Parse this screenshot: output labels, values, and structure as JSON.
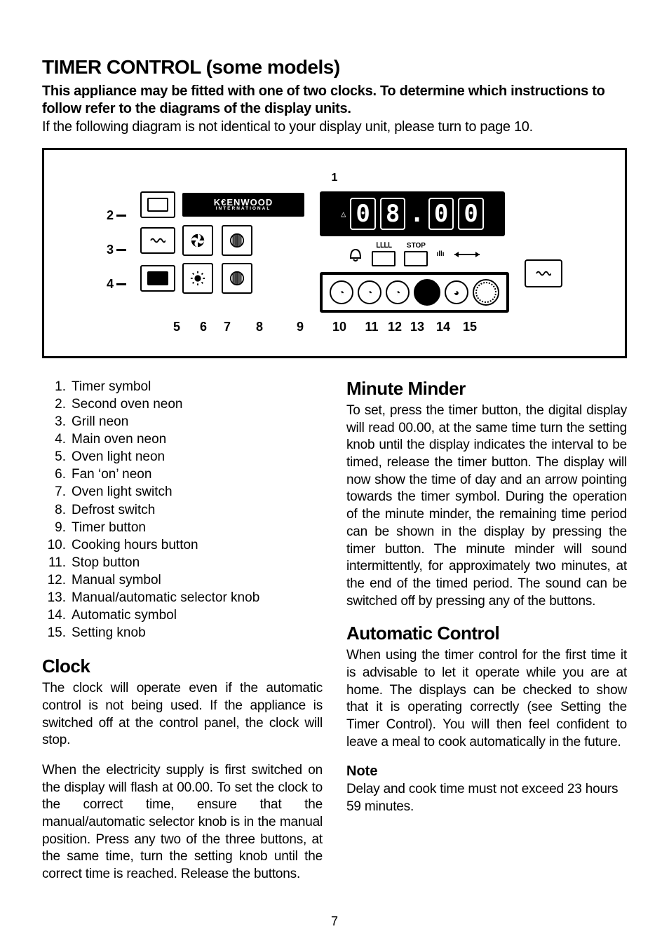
{
  "header": {
    "title": "TIMER CONTROL (some models)",
    "subhead": "This appliance may be fitted with one of two clocks. To determine which instructions to follow refer to the diagrams of the display units.",
    "lead": "If the following diagram is not identical to your display unit, please turn to page 10."
  },
  "diagram": {
    "top_callout": "1",
    "left_callouts": [
      "2",
      "3",
      "4"
    ],
    "brand_line1": "K€ENWOOD",
    "brand_line2": "INTERNATIONAL",
    "display_value": "08.00",
    "button_labels": {
      "timer": "",
      "cook": "ⅬⅬⅬⅬ",
      "stop": "STOP",
      "manual": "ıllı"
    },
    "bottom_callouts": [
      "5",
      "6",
      "7",
      "8",
      "9",
      "10",
      "11",
      "12",
      "13",
      "14",
      "15"
    ]
  },
  "legend": [
    "Timer symbol",
    "Second oven neon",
    "Grill neon",
    "Main oven neon",
    "Oven light neon",
    "Fan ‘on’ neon",
    "Oven light switch",
    "Defrost switch",
    "Timer button",
    "Cooking hours button",
    "Stop button",
    "Manual symbol",
    "Manual/automatic selector knob",
    "Automatic symbol",
    "Setting knob"
  ],
  "sections": {
    "clock_h": "Clock",
    "clock_p1": "The clock will operate even if the automatic control is not being used. If the appliance is switched off at the control panel, the clock will stop.",
    "clock_p2": "When the electricity supply is first switched on the display will flash at 00.00. To set the clock to the correct time, ensure that the manual/automatic selector knob is in the manual position. Press any two of the three buttons, at the same time, turn the setting knob until the correct time is reached. Release the buttons.",
    "minute_h": "Minute Minder",
    "minute_p": "To set, press the timer button, the digital display will read 00.00, at the same time turn the setting knob until the display indicates the interval to be timed, release the timer button. The display will now show the time of day and an arrow pointing towards the timer symbol. During the operation of the minute minder, the remaining time period can be shown in the display by pressing the timer button. The minute minder will sound intermittently, for approximately two minutes, at the end of the timed period. The sound can be switched off by pressing any of the buttons.",
    "auto_h": "Automatic Control",
    "auto_p": "When using the timer control for the first time it is advisable to let it operate while you are at home. The displays can be checked to show that it is operating correctly (see Setting the Timer Control). You will then feel confident to leave a meal to cook automatically in the future.",
    "note_h": "Note",
    "note_p": "Delay and cook time must not exceed 23 hours 59 minutes."
  },
  "page_number": "7"
}
